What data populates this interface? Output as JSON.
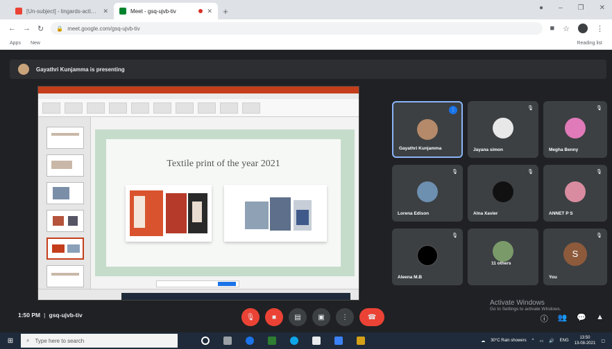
{
  "browser": {
    "tabs": [
      {
        "title": "[Un-subject] - lingards-action@g",
        "active": false
      },
      {
        "title": "Meet - gsq-ujvb-tiv",
        "active": true
      }
    ],
    "new_tab_icon": "plus-icon",
    "url": "meet.google.com/gsq-ujvb-tiv",
    "bookmarks": {
      "apps": "Apps",
      "item2": "New",
      "reading_list": "Reading list"
    }
  },
  "meet": {
    "presenting_text": "Gayathri Kunjamma is presenting",
    "slide_title": "Textile print of the year 2021",
    "participants": [
      {
        "name": "Gayathri Kunjamma",
        "speaking": true
      },
      {
        "name": "Jayana simon"
      },
      {
        "name": "Megha Benny"
      },
      {
        "name": "Lorena Edison"
      },
      {
        "name": "Alna Xavier"
      },
      {
        "name": "ANNET P S"
      },
      {
        "name": "Aleena M.B"
      },
      {
        "name": "11 others"
      },
      {
        "name": "You",
        "initial": "S"
      }
    ],
    "time": "1:50 PM",
    "meeting_code": "gsq-ujvb-tiv",
    "activate_title": "Activate Windows",
    "activate_sub": "Go to Settings to activate Windows."
  },
  "taskbar": {
    "search_placeholder": "Type here to search",
    "weather": "30°C Rain showers",
    "clock_time": "13:50",
    "clock_date": "13-08-2021",
    "lang": "ENG"
  },
  "colors": {
    "accent": "#1a73e8",
    "hangup": "#ea4335",
    "ppt": "#c43e1c",
    "slide_bg": "#c6dccb"
  }
}
